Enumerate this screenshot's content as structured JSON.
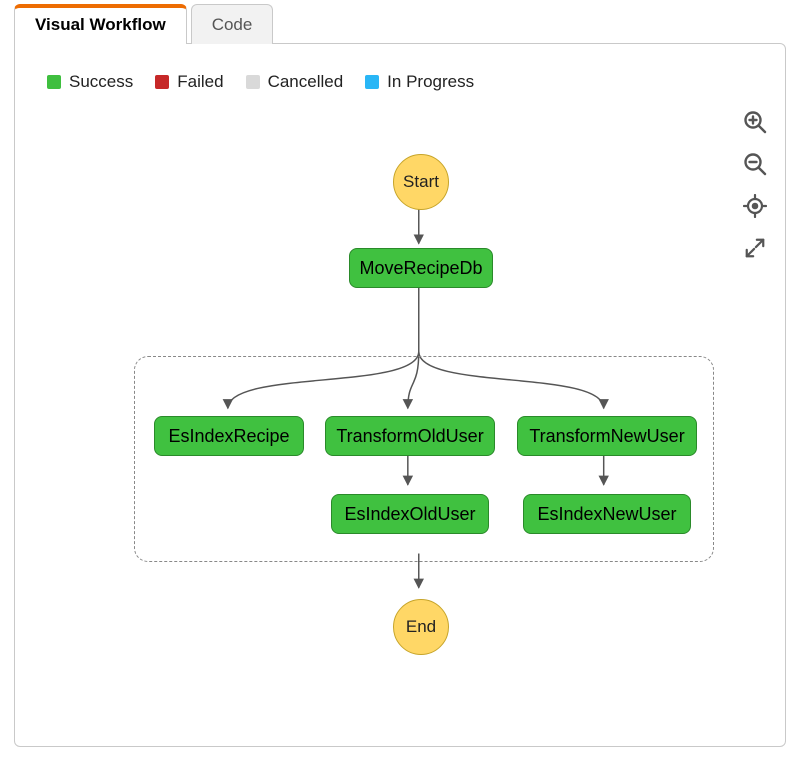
{
  "tabs": [
    {
      "id": "visual",
      "label": "Visual Workflow",
      "active": true
    },
    {
      "id": "code",
      "label": "Code",
      "active": false
    }
  ],
  "legend": {
    "success": {
      "label": "Success",
      "color": "#3fbf3f"
    },
    "failed": {
      "label": "Failed",
      "color": "#c62828"
    },
    "cancelled": {
      "label": "Cancelled",
      "color": "#d9d9d9"
    },
    "in_progress": {
      "label": "In Progress",
      "color": "#29b6f6"
    }
  },
  "status_colors": {
    "success": "#3fbf3f",
    "node_border": "#2a8a2a",
    "accent": "#ed6c02",
    "start_end_fill": "#ffd766",
    "start_end_border": "#c7a52a"
  },
  "workflow": {
    "start": {
      "label": "Start"
    },
    "end": {
      "label": "End"
    },
    "nodes": {
      "move_recipe_db": {
        "label": "MoveRecipeDb",
        "status": "success"
      },
      "es_index_recipe": {
        "label": "EsIndexRecipe",
        "status": "success"
      },
      "transform_old_user": {
        "label": "TransformOldUser",
        "status": "success"
      },
      "transform_new_user": {
        "label": "TransformNewUser",
        "status": "success"
      },
      "es_index_old_user": {
        "label": "EsIndexOldUser",
        "status": "success"
      },
      "es_index_new_user": {
        "label": "EsIndexNewUser",
        "status": "success"
      }
    },
    "structure": {
      "sequence": [
        "start",
        "move_recipe_db",
        {
          "parallel": [
            [
              "es_index_recipe"
            ],
            [
              "transform_old_user",
              "es_index_old_user"
            ],
            [
              "transform_new_user",
              "es_index_new_user"
            ]
          ]
        },
        "end"
      ]
    }
  }
}
